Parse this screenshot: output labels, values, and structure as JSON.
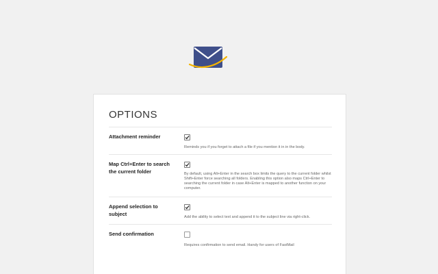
{
  "logo": {
    "name": "mail-envelope-logo",
    "colors": {
      "envelope": "#3f4f8a",
      "swoosh": "#f4b400"
    }
  },
  "options": {
    "title": "OPTIONS",
    "items": [
      {
        "label": "Attachment reminder",
        "checked": true,
        "description": "Reminds you if you forget to attach a file if you mention it in in the body."
      },
      {
        "label": "Map Ctrl+Enter to search the current folder",
        "checked": true,
        "description": "By default, using Alt+Enter in the search box limits the query to the current folder whilst Shift+Enter force searching all folders. Enabling this option also maps Ctrl+Enter to searching the current folder in case Alt+Enter is mapped to another function on your computer."
      },
      {
        "label": "Append selection to subject",
        "checked": true,
        "description": "Add the ability to select text and append it to the subject line via right-click."
      },
      {
        "label": "Send confirmation",
        "checked": false,
        "description": "Requires confirmation to send email. Handy for users of FastMail"
      }
    ]
  }
}
